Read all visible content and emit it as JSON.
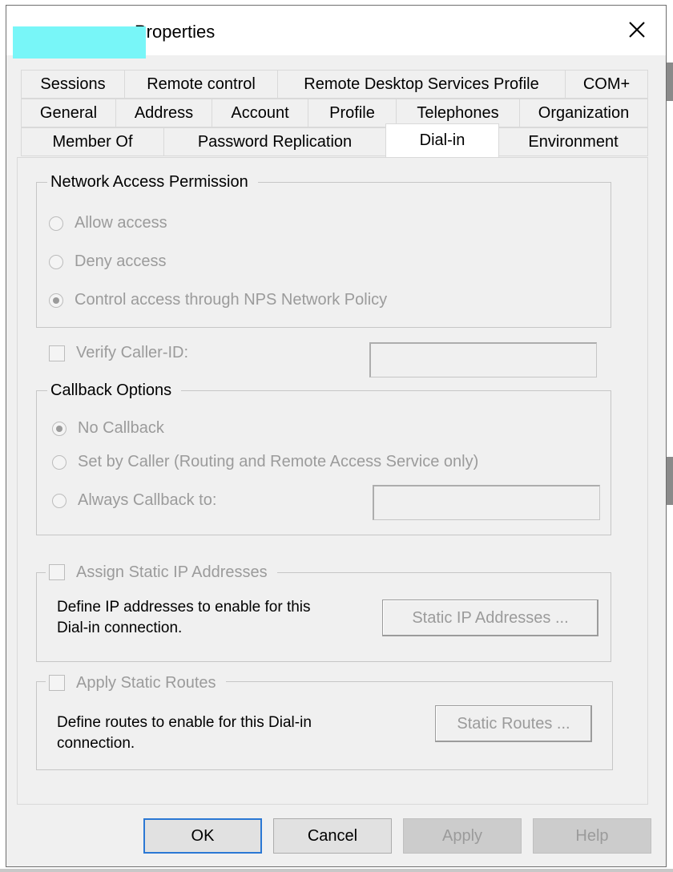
{
  "window": {
    "title": "Properties",
    "close_label": "✕"
  },
  "tabs": {
    "row1": [
      "Sessions",
      "Remote control",
      "Remote Desktop Services Profile",
      "COM+"
    ],
    "row2": [
      "General",
      "Address",
      "Account",
      "Profile",
      "Telephones",
      "Organization"
    ],
    "row3": [
      "Member Of",
      "Password Replication",
      "Dial-in",
      "Environment"
    ],
    "active": "Dial-in"
  },
  "network_access": {
    "legend": "Network Access Permission",
    "options": [
      "Allow access",
      "Deny access",
      "Control access through NPS Network Policy"
    ],
    "selected": "Control access through NPS Network Policy"
  },
  "verify_caller_id": {
    "label": "Verify Caller-ID:",
    "value": ""
  },
  "callback": {
    "legend": "Callback Options",
    "options": [
      "No Callback",
      "Set by Caller (Routing and Remote Access Service only)",
      "Always Callback to:"
    ],
    "selected": "No Callback",
    "callback_number": ""
  },
  "static_ip": {
    "legend": "Assign Static IP Addresses",
    "description_line1": "Define IP addresses to enable for this",
    "description_line2": "Dial-in connection.",
    "button": "Static IP Addresses ..."
  },
  "static_routes": {
    "legend": "Apply Static Routes",
    "description_line1": "Define routes to enable for this Dial-in",
    "description_line2": "connection.",
    "button": "Static Routes ..."
  },
  "footer": {
    "ok": "OK",
    "cancel": "Cancel",
    "apply": "Apply",
    "help": "Help"
  },
  "colors": {
    "redaction": "#78f6f8",
    "default_button_border": "#2b78d4",
    "disabled_text": "#9b9b9b"
  }
}
